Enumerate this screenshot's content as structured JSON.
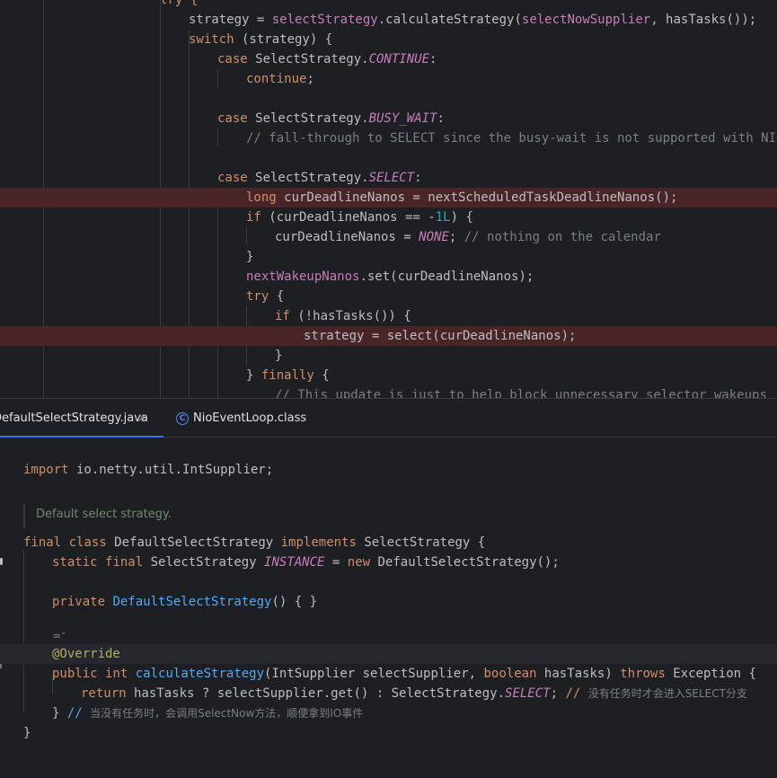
{
  "editor_top": {
    "lines": [
      {
        "tokens": [
          {
            "t": "try {",
            "c": "kw"
          }
        ]
      },
      {
        "tokens": [
          {
            "t": "strategy = "
          },
          {
            "t": "selectStrategy",
            "c": "fld"
          },
          {
            "t": ".calculateStrategy("
          },
          {
            "t": "selectNowSupplier",
            "c": "fld"
          },
          {
            "t": ", hasTasks());"
          }
        ]
      },
      {
        "tokens": [
          {
            "t": "switch",
            "c": "kw"
          },
          {
            "t": " (strategy) {"
          }
        ]
      },
      {
        "tokens": [
          {
            "t": "case",
            "c": "kw"
          },
          {
            "t": " SelectStrategy."
          },
          {
            "t": "CONTINUE",
            "c": "sfld"
          },
          {
            "t": ":"
          }
        ]
      },
      {
        "tokens": [
          {
            "t": "continue",
            "c": "kw"
          },
          {
            "t": ";"
          }
        ]
      },
      {
        "tokens": []
      },
      {
        "tokens": [
          {
            "t": "case",
            "c": "kw"
          },
          {
            "t": " SelectStrategy."
          },
          {
            "t": "BUSY_WAIT",
            "c": "sfld"
          },
          {
            "t": ":"
          }
        ]
      },
      {
        "tokens": [
          {
            "t": "// fall-through to SELECT since the busy-wait is not supported with NIO",
            "c": "cm"
          }
        ]
      },
      {
        "tokens": []
      },
      {
        "tokens": [
          {
            "t": "case",
            "c": "kw"
          },
          {
            "t": " SelectStrategy."
          },
          {
            "t": "SELECT",
            "c": "sfld"
          },
          {
            "t": ":"
          }
        ]
      },
      {
        "tokens": [
          {
            "t": "long",
            "c": "kw"
          },
          {
            "t": " curDeadlineNanos = nextScheduledTaskDeadlineNanos();"
          }
        ]
      },
      {
        "tokens": [
          {
            "t": "if",
            "c": "kw"
          },
          {
            "t": " (curDeadlineNanos == -"
          },
          {
            "t": "1L",
            "c": "num"
          },
          {
            "t": ") {"
          }
        ]
      },
      {
        "tokens": [
          {
            "t": "curDeadlineNanos = "
          },
          {
            "t": "NONE",
            "c": "sfld"
          },
          {
            "t": "; "
          },
          {
            "t": "// nothing on the calendar",
            "c": "cm"
          }
        ]
      },
      {
        "tokens": [
          {
            "t": "}"
          }
        ]
      },
      {
        "tokens": [
          {
            "t": "nextWakeupNanos",
            "c": "fld"
          },
          {
            "t": ".set(curDeadlineNanos);"
          }
        ]
      },
      {
        "tokens": [
          {
            "t": "try",
            "c": "kw"
          },
          {
            "t": " {"
          }
        ]
      },
      {
        "tokens": [
          {
            "t": "if",
            "c": "kw"
          },
          {
            "t": " (!hasTasks()) {"
          }
        ]
      },
      {
        "tokens": [
          {
            "t": "strategy = select(curDeadlineNanos);"
          }
        ]
      },
      {
        "tokens": [
          {
            "t": "}"
          }
        ]
      },
      {
        "tokens": [
          {
            "t": "} "
          },
          {
            "t": "finally",
            "c": "kw"
          },
          {
            "t": " {"
          }
        ]
      },
      {
        "tokens": [
          {
            "t": "// This update is just to help block unnecessary selector wakeups",
            "c": "cm"
          }
        ]
      }
    ]
  },
  "tabs": [
    {
      "label": "DefaultSelectStrategy.java",
      "active": true,
      "close_glyph": "×"
    },
    {
      "label": "NioEventLoop.class",
      "active": false,
      "icon_letter": "C"
    }
  ],
  "editor_bottom": {
    "doc_comment": "Default select strategy.",
    "hint_glyph": "♒˅",
    "lines": [
      {
        "tokens": [
          {
            "t": "import",
            "c": "kw"
          },
          {
            "t": " io.netty.util.IntSupplier;"
          }
        ]
      },
      {
        "tokens": [
          {
            "t": "final",
            "c": "kw"
          },
          {
            "t": " "
          },
          {
            "t": "class",
            "c": "kw"
          },
          {
            "t": " DefaultSelectStrategy "
          },
          {
            "t": "implements",
            "c": "kw"
          },
          {
            "t": " SelectStrategy {"
          }
        ]
      },
      {
        "tokens": [
          {
            "t": "static",
            "c": "kw"
          },
          {
            "t": " "
          },
          {
            "t": "final",
            "c": "kw"
          },
          {
            "t": " SelectStrategy "
          },
          {
            "t": "INSTANCE",
            "c": "sfld"
          },
          {
            "t": " = "
          },
          {
            "t": "new",
            "c": "kw"
          },
          {
            "t": " DefaultSelectStrategy();"
          }
        ]
      },
      {
        "tokens": [
          {
            "t": "private",
            "c": "kw"
          },
          {
            "t": " "
          },
          {
            "t": "DefaultSelectStrategy",
            "c": "fn"
          },
          {
            "t": "() { }"
          }
        ]
      },
      {
        "tokens": [
          {
            "t": "@Override",
            "c": "ann"
          }
        ]
      },
      {
        "tokens": [
          {
            "t": "public",
            "c": "kw"
          },
          {
            "t": " "
          },
          {
            "t": "int",
            "c": "kw"
          },
          {
            "t": " "
          },
          {
            "t": "calculateStrategy",
            "c": "fn"
          },
          {
            "t": "(IntSupplier selectSupplier, "
          },
          {
            "t": "boolean",
            "c": "kw"
          },
          {
            "t": " hasTasks) "
          },
          {
            "t": "throws",
            "c": "kw"
          },
          {
            "t": " Exception {"
          }
        ]
      },
      {
        "tokens": [
          {
            "t": "return",
            "c": "kw"
          },
          {
            "t": " hasTasks ? selectSupplier.get() : SelectStrategy."
          },
          {
            "t": "SELECT",
            "c": "sfld"
          },
          {
            "t": "; "
          },
          {
            "t": "// ",
            "c": "kw"
          },
          {
            "t": "没有任务时才会进入SELECT分支",
            "c": "cm cjk"
          }
        ]
      },
      {
        "tokens": [
          {
            "t": "} "
          },
          {
            "t": "// ",
            "c": "fn"
          },
          {
            "t": "当没有任务时，会调用SelectNow方法，顺便拿到IO事件",
            "c": "cm cjk"
          }
        ]
      },
      {
        "tokens": [
          {
            "t": "}"
          }
        ]
      }
    ]
  }
}
